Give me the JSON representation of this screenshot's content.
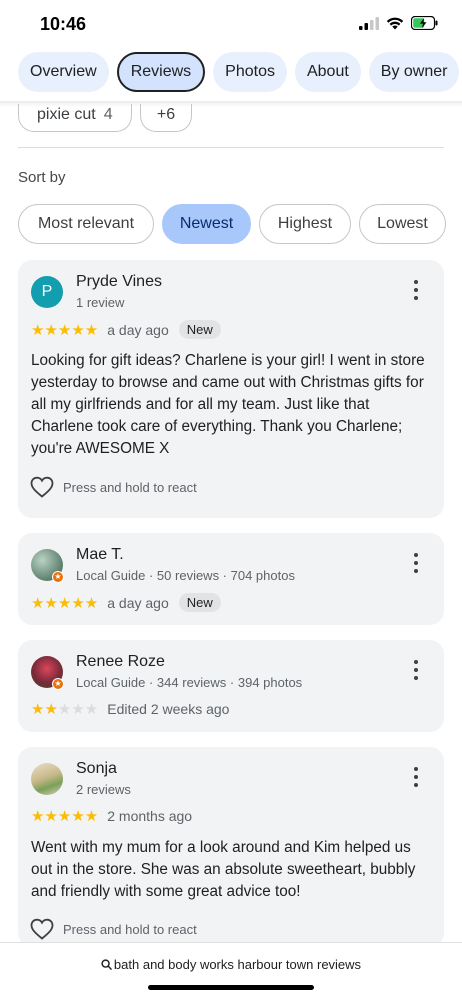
{
  "status": {
    "time": "10:46"
  },
  "tabs": [
    {
      "label": "Overview"
    },
    {
      "label": "Reviews",
      "active": true
    },
    {
      "label": "Photos"
    },
    {
      "label": "About"
    },
    {
      "label": "By owner"
    }
  ],
  "topic_chips": [
    {
      "label": "pixie cut",
      "count": "4"
    },
    {
      "label": "+6"
    }
  ],
  "sort": {
    "label": "Sort by",
    "options": [
      "Most relevant",
      "Newest",
      "Highest",
      "Lowest"
    ],
    "selected": "Newest"
  },
  "reviews": [
    {
      "avatar_letter": "P",
      "avatar_color": "#129eaf",
      "name": "Pryde Vines",
      "meta": "1 review",
      "rating": 5,
      "when": "a day ago",
      "badge": "New",
      "text": "Looking for gift ideas? Charlene is your girl! I went in store yesterday to browse and came out with Christmas gifts for all my girlfriends and for all my team. Just like that Charlene took care of everything. Thank you Charlene; you're AWESOME X",
      "react_label": "Press and hold to react"
    },
    {
      "name": "Mae T.",
      "meta": "Local Guide · 50 reviews · 704 photos",
      "rating": 5,
      "when": "a day ago",
      "badge": "New"
    },
    {
      "name": "Renee Roze",
      "meta": "Local Guide · 344 reviews · 394 photos",
      "rating": 2,
      "when": "Edited 2 weeks ago"
    },
    {
      "name": "Sonja",
      "meta": "2 reviews",
      "rating": 5,
      "when": "2 months ago",
      "text": "Went with my mum for a look around and Kim helped us out in the store. She was an absolute sweetheart, bubbly and friendly with some great advice too!",
      "react_label": "Press and hold to react"
    }
  ],
  "bottom_search": {
    "query": "bath and body works harbour town reviews",
    "icon": "search-icon"
  },
  "colors": {
    "star": "#fbbc04",
    "selected_chip": "#a8c7fa",
    "tab_bg": "#e8effd",
    "card_bg": "#f1f3f4"
  }
}
